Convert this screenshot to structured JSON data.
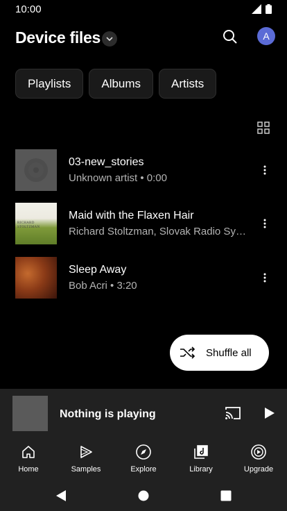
{
  "status_bar": {
    "time": "10:00",
    "icons": [
      "signal-icon",
      "battery-icon"
    ]
  },
  "header": {
    "title": "Device files",
    "avatar_letter": "A",
    "avatar_color": "#5b6bd6"
  },
  "chips": [
    {
      "label": "Playlists"
    },
    {
      "label": "Albums"
    },
    {
      "label": "Artists"
    }
  ],
  "tracks": [
    {
      "title": "03-new_stories",
      "subtitle": "Unknown artist • 0:00",
      "art": "placeholder-disc"
    },
    {
      "title": "Maid with the Flaxen Hair",
      "subtitle": "Richard Stoltzman, Slovak Radio Sy…",
      "art": "album-cover-green",
      "art_text": "RICHARD STOLTZMAN"
    },
    {
      "title": "Sleep Away",
      "subtitle": "Bob Acri • 3:20",
      "art": "album-cover-orange"
    }
  ],
  "shuffle": {
    "label": "Shuffle all"
  },
  "mini_player": {
    "title": "Nothing is playing"
  },
  "bottom_nav": [
    {
      "label": "Home",
      "icon": "home-icon"
    },
    {
      "label": "Samples",
      "icon": "samples-icon"
    },
    {
      "label": "Explore",
      "icon": "compass-icon"
    },
    {
      "label": "Library",
      "icon": "library-icon"
    },
    {
      "label": "Upgrade",
      "icon": "upgrade-icon"
    }
  ],
  "system_nav": [
    "back-icon",
    "home-circle-icon",
    "recents-icon"
  ]
}
